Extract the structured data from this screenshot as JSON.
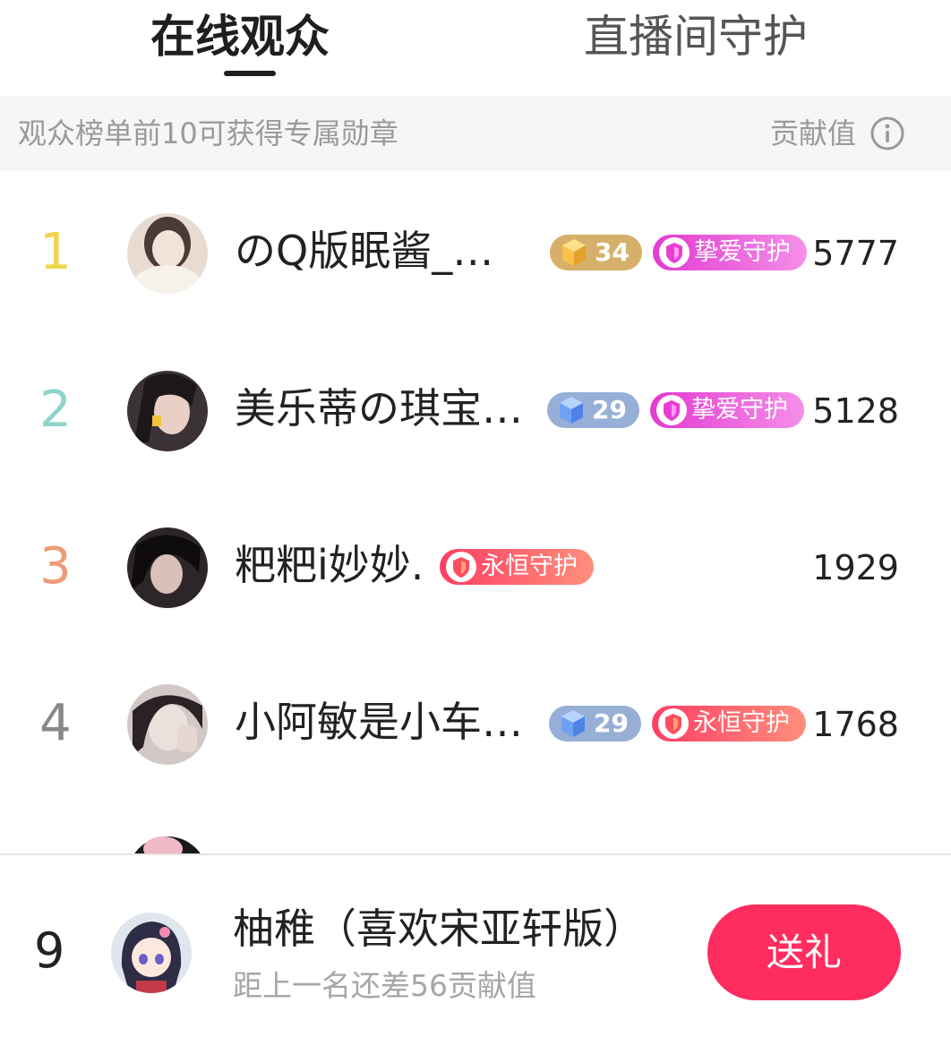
{
  "tabs": {
    "active_label": "在线观众",
    "inactive_label": "直播间守护"
  },
  "hint": {
    "text": "观众榜单前10可获得专属勋章",
    "right_label": "贡献值"
  },
  "colors": {
    "rank1": "#f2d54b",
    "rank2": "#8fd3cb",
    "rank3": "#ee9b78",
    "rank_other": "#888888",
    "gold_badge": "#d6b06a",
    "blue_badge": "#97afd6",
    "pink_guard": "#f04fd8",
    "red_guard": "#ff5c6c",
    "gift_button": "#ff2c5f"
  },
  "rows": [
    {
      "rank": "1",
      "name": "のQ版眠酱_…",
      "level": "34",
      "level_type": "gold",
      "guard": "挚爱守护",
      "guard_type": "pink",
      "score": "5777"
    },
    {
      "rank": "2",
      "name": "美乐蒂の琪宝…",
      "level": "29",
      "level_type": "blue",
      "guard": "挚爱守护",
      "guard_type": "pink",
      "score": "5128"
    },
    {
      "rank": "3",
      "name": "粑粑i妙妙.",
      "level": "",
      "level_type": "none",
      "guard": "永恒守护",
      "guard_type": "red",
      "score": "1929"
    },
    {
      "rank": "4",
      "name": "小阿敏是小车…",
      "level": "29",
      "level_type": "blue",
      "guard": "永恒守护",
      "guard_type": "red",
      "score": "1768"
    }
  ],
  "self": {
    "rank": "9",
    "name": "柚稚（喜欢宋亚轩版）",
    "subtitle": "距上一名还差56贡献值",
    "gift_label": "送礼"
  }
}
